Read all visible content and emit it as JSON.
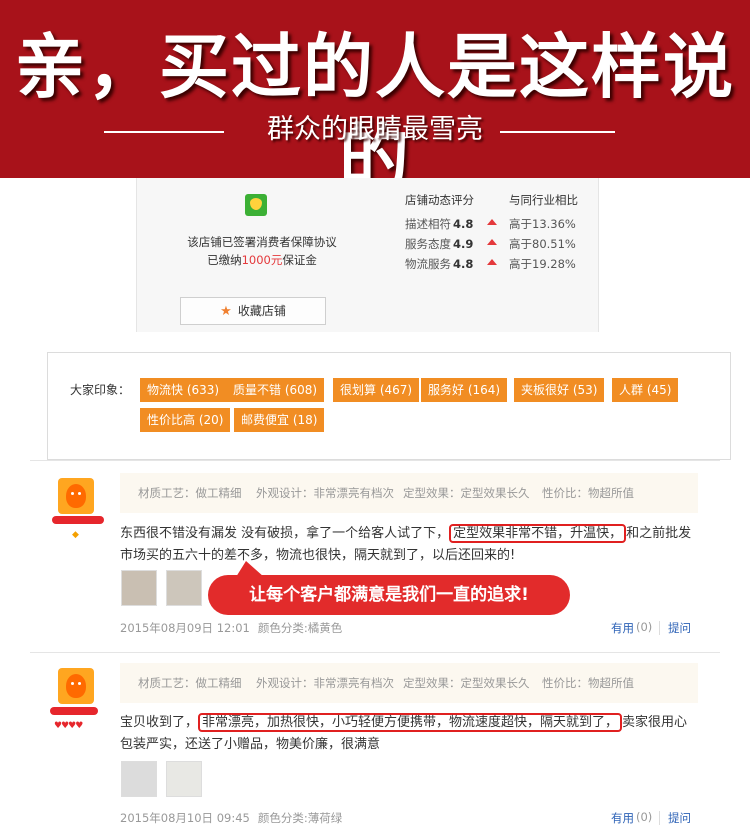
{
  "banner": {
    "title": "亲，买过的人是这样说的",
    "subtitle": "群众的眼睛最雪亮"
  },
  "shop": {
    "agreement_line1": "该店铺已签署消费者保障协议",
    "agreement_prefix": "已缴纳",
    "deposit_amount": "1000元",
    "agreement_suffix": "保证金",
    "rating_header": "店铺动态评分",
    "compare_header": "与同行业相比",
    "ratings": [
      {
        "label": "描述相符",
        "score": "4.8",
        "diff": "高于13.36%"
      },
      {
        "label": "服务态度",
        "score": "4.9",
        "diff": "高于80.51%"
      },
      {
        "label": "物流服务",
        "score": "4.8",
        "diff": "高于19.28%"
      }
    ],
    "favorite_label": "收藏店铺"
  },
  "impressions": {
    "label": "大家印象：",
    "tags": [
      "物流快 (633)",
      "质量不错 (608)",
      "很划算 (467)",
      "服务好 (164)",
      "夹板很好 (53)",
      "人群 (45)",
      "性价比高 (20)",
      "邮费便宜 (18)"
    ]
  },
  "reviews": [
    {
      "attrs": [
        "材质工艺：做工精细",
        "外观设计：非常漂亮有档次",
        "定型效果：定型效果长久",
        "性价比：物超所值"
      ],
      "text_part1": "东西很不错没有漏发 没有破损，拿了一个给客人试了下，",
      "highlight": "定型效果非常不错，升温快，",
      "text_part2": "和之前批发市场买的五六十的差不多，物流也很快，隔天就到了，以后还回来的!",
      "date": "2015年08月09日 12:01",
      "color": "颜色分类:橘黄色",
      "useful_label": "有用",
      "useful_count": "(0)",
      "ask_label": "提问"
    },
    {
      "attrs": [
        "材质工艺：做工精细",
        "外观设计：非常漂亮有档次",
        "定型效果：定型效果长久",
        "性价比：物超所值"
      ],
      "text_part1": "宝贝收到了，",
      "highlight": "非常漂亮，加热很快，小巧轻便方便携带，物流速度超快，隔天就到了，",
      "text_part2": "卖家很用心包装严实，还送了小赠品，物美价廉，很满意",
      "date": "2015年08月10日 09:45",
      "color": "颜色分类:薄荷绿",
      "useful_label": "有用",
      "useful_count": "(0)",
      "ask_label": "提问"
    }
  ],
  "promo_bubble": "让每个客户都满意是我们一直的追求!",
  "colors": {
    "banner_red": "#a8121a",
    "tag_orange": "#f18d23",
    "highlight_red": "#e02020",
    "link_blue": "#2d62b6"
  }
}
